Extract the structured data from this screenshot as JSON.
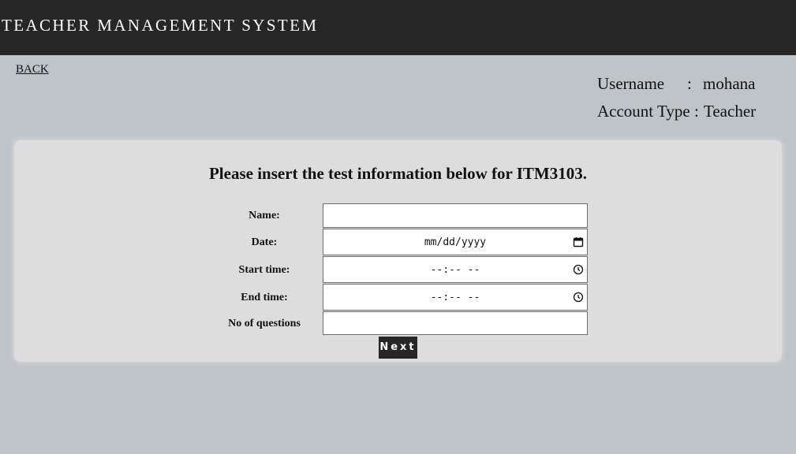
{
  "header": {
    "app_title": "TEACHER MANAGEMENT SYSTEM"
  },
  "nav": {
    "back_label": "BACK"
  },
  "account": {
    "username_label": "Username",
    "username_sep": ":",
    "username_value": "mohana",
    "type_label": "Account Type :",
    "type_value": "Teacher"
  },
  "form": {
    "heading": "Please insert the test information below for ITM3103.",
    "fields": {
      "name": {
        "label": "Name:",
        "value": ""
      },
      "date": {
        "label": "Date:",
        "placeholder": "mm/dd/yyyy",
        "icon": "calendar-icon"
      },
      "start_time": {
        "label": "Start time:",
        "placeholder": "--:-- --",
        "icon": "clock-icon"
      },
      "end_time": {
        "label": "End time:",
        "placeholder": "--:-- --",
        "icon": "clock-icon"
      },
      "num_questions": {
        "label": "No of questions",
        "value": ""
      }
    },
    "next_label": "Next"
  },
  "colors": {
    "header_bg": "#262626",
    "page_bg": "#bfc4c8",
    "panel_bg": "#dddddd",
    "button_bg": "#262626"
  }
}
